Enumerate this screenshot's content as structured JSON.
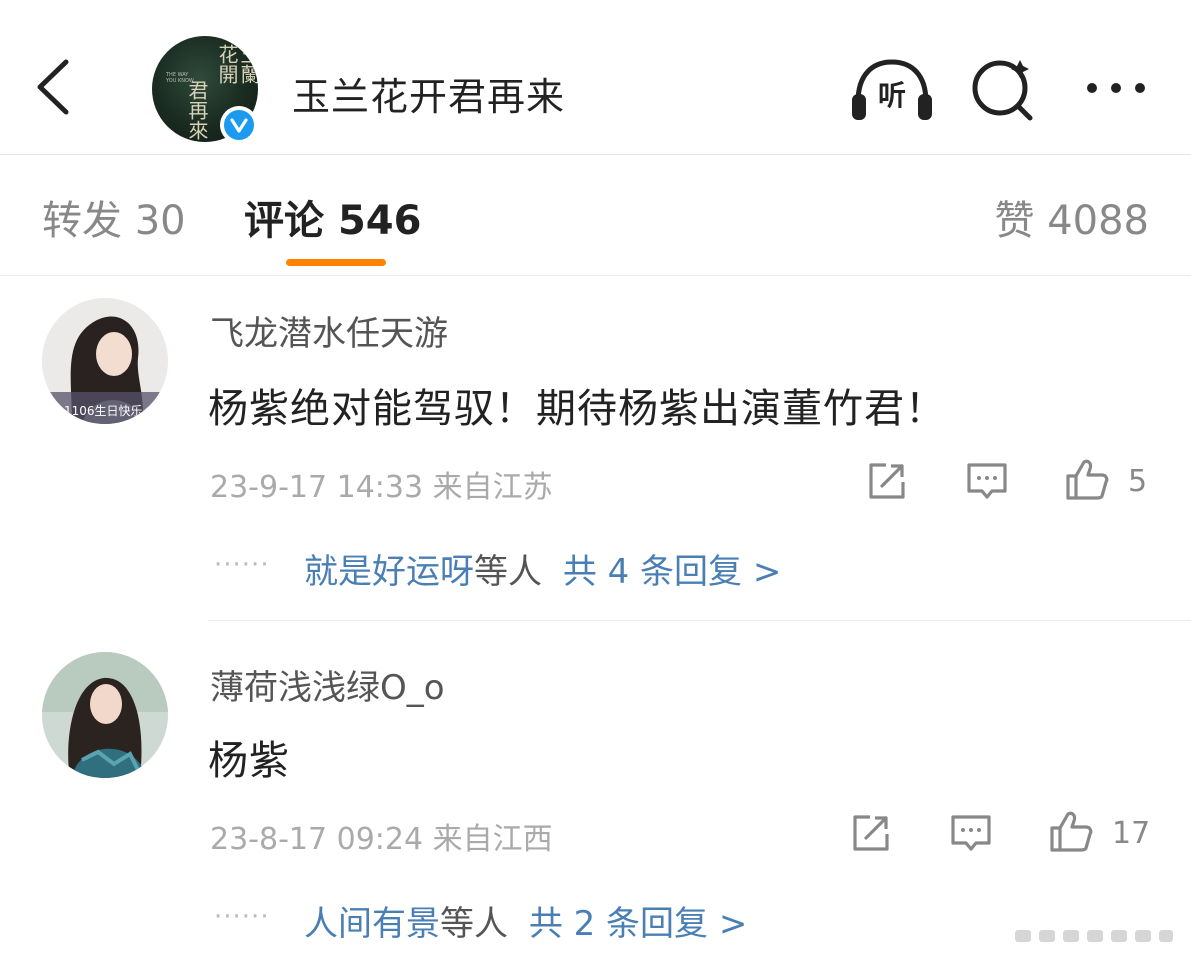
{
  "header": {
    "title": "玉兰花开君再来",
    "listen_label": "听",
    "avatar_text": "玉蘭花開君再來"
  },
  "tabs": {
    "repost_label": "转发",
    "repost_count": "30",
    "comment_label": "评论",
    "comment_count": "546",
    "like_label": "赞",
    "like_count": "4088"
  },
  "comments": [
    {
      "username": "飞龙潜水任天游",
      "text": "杨紫绝对能驾驭！期待杨紫出演董竹君！",
      "time": "23-9-17 14:33",
      "location": "来自江苏",
      "likes": "5",
      "avatar_caption": "1106生日快乐",
      "reply_dots": "······",
      "reply_user": "就是好运呀",
      "reply_suffix": "等人",
      "reply_total": "共 4 条回复 >"
    },
    {
      "username": "薄荷浅浅绿O_o",
      "text": "杨紫",
      "time": "23-8-17 09:24",
      "location": "来自江西",
      "likes": "17",
      "reply_dots": "······",
      "reply_user": "人间有景",
      "reply_suffix": "等人",
      "reply_total": "共 2 条回复 >"
    }
  ],
  "colors": {
    "accent_orange": "#ff8200",
    "link_blue": "#4a7fb5",
    "verified_blue": "#1b9bf0"
  }
}
